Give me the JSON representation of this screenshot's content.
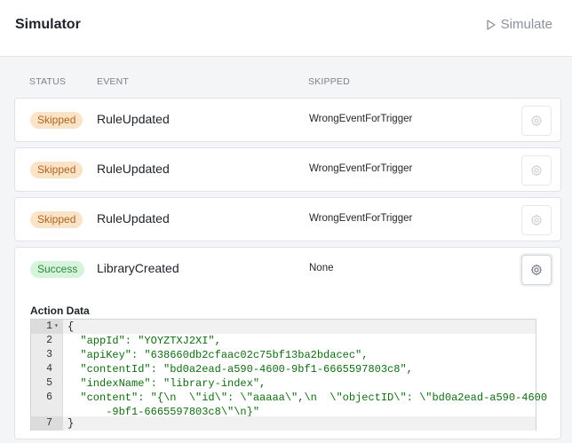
{
  "header": {
    "title": "Simulator",
    "simulate_label": "Simulate"
  },
  "table": {
    "columns": [
      "STATUS",
      "EVENT",
      "SKIPPED"
    ],
    "rows": [
      {
        "status": "Skipped",
        "event": "RuleUpdated",
        "skipped": "WrongEventForTrigger"
      },
      {
        "status": "Skipped",
        "event": "RuleUpdated",
        "skipped": "WrongEventForTrigger"
      },
      {
        "status": "Skipped",
        "event": "RuleUpdated",
        "skipped": "WrongEventForTrigger"
      },
      {
        "status": "Success",
        "event": "LibraryCreated",
        "skipped": "None"
      }
    ]
  },
  "detail": {
    "label": "Action Data",
    "code_lines": [
      {
        "num": "1",
        "text": "{"
      },
      {
        "num": "2",
        "text": "  \"appId\": \"YOYZTXJ2XI\","
      },
      {
        "num": "3",
        "text": "  \"apiKey\": \"638660db2cfaac02c75bf13ba2bdacec\","
      },
      {
        "num": "4",
        "text": "  \"contentId\": \"bd0a2ead-a590-4600-9bf1-6665597803c8\","
      },
      {
        "num": "5",
        "text": "  \"indexName\": \"library-index\","
      },
      {
        "num": "6",
        "text": "  \"content\": \"{\\n  \\\"id\\\": \\\"aaaaa\\\",\\n  \\\"objectID\\\": \\\"bd0a2ead-a590-4600"
      },
      {
        "num": "",
        "text": "      -9bf1-6665597803c8\\\"\\n}\""
      },
      {
        "num": "7",
        "text": "}"
      }
    ]
  },
  "colors": {
    "skipped_bg": "#fbe3c7",
    "skipped_fg": "#b0641e",
    "success_bg": "#d7f3dc",
    "success_fg": "#2a8a3e"
  },
  "icons": {
    "simulate": "play-icon",
    "row_action": "gear-icon"
  }
}
